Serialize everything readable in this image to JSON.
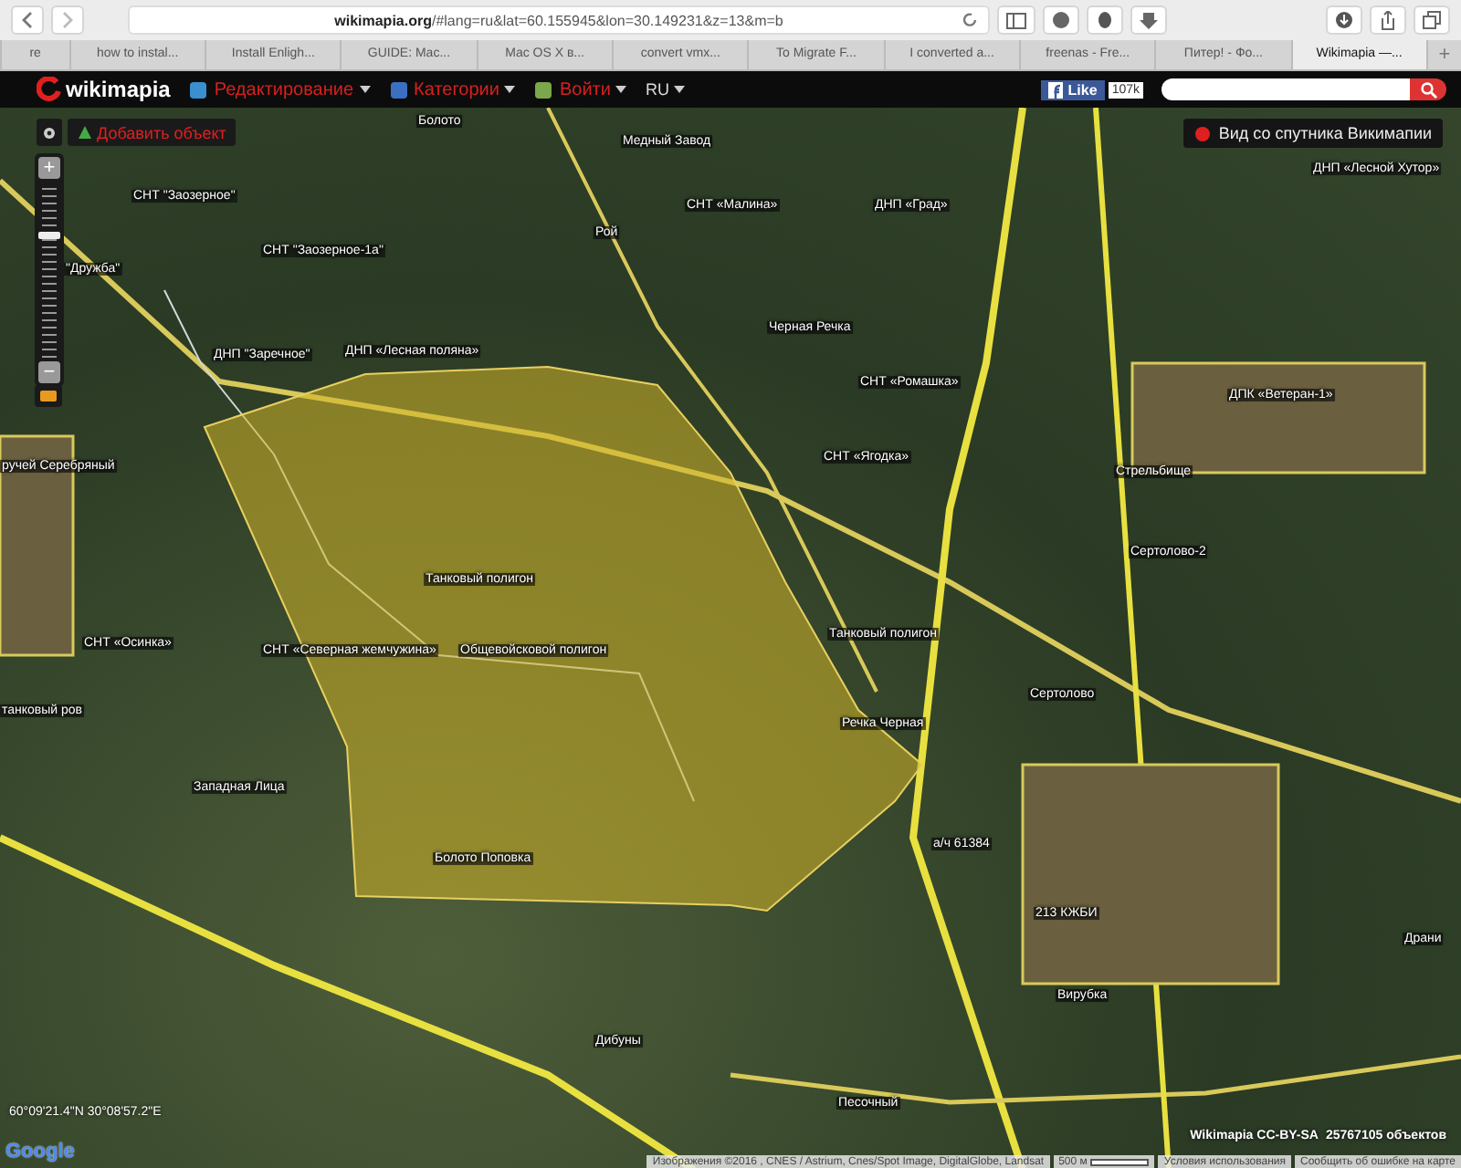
{
  "browser": {
    "url_host": "wikimapia.org",
    "url_rest": "/#lang=ru&lat=60.155945&lon=30.149231&z=13&m=b",
    "tabs": [
      {
        "label": "re",
        "selected": false
      },
      {
        "label": "how to instal...",
        "selected": false
      },
      {
        "label": "Install Enligh...",
        "selected": false
      },
      {
        "label": "GUIDE: Mac...",
        "selected": false
      },
      {
        "label": "Mac OS X в...",
        "selected": false
      },
      {
        "label": "convert vmx...",
        "selected": false
      },
      {
        "label": "To Migrate F...",
        "selected": false
      },
      {
        "label": "I converted a...",
        "selected": false
      },
      {
        "label": "freenas - Fre...",
        "selected": false
      },
      {
        "label": "Питер! - Фо...",
        "selected": false
      },
      {
        "label": "Wikimapia —...",
        "selected": true
      }
    ],
    "new_tab": "+"
  },
  "topbar": {
    "logo": "wikimapia",
    "menu": [
      {
        "label": "Редактирование",
        "kind": "edit"
      },
      {
        "label": "Категории",
        "kind": "categories"
      },
      {
        "label": "Войти",
        "kind": "login"
      }
    ],
    "language": "RU",
    "like_label": "Like",
    "like_count": "107k"
  },
  "map": {
    "add_object": "Добавить объект",
    "satellite_label": "Вид со спутника Викимапии",
    "zoom_plus": "+",
    "zoom_minus": "−",
    "zoom": {
      "level": 0.7
    },
    "labels": [
      {
        "text": "Болото"
      },
      {
        "text": "Медный Завод"
      },
      {
        "text": "ДНП «Лесной Хутор»"
      },
      {
        "text": "СНТ \"Заозерное\""
      },
      {
        "text": "СНТ «Малина»"
      },
      {
        "text": "ДНП «Град»"
      },
      {
        "text": "Рой"
      },
      {
        "text": "СНТ \"Заозерное-1а\""
      },
      {
        "text": "\"Дружба\""
      },
      {
        "text": "Черная Речка"
      },
      {
        "text": "ДНП \"Заречное\""
      },
      {
        "text": "ДНП «Лесная поляна»"
      },
      {
        "text": "СНТ «Ромашка»"
      },
      {
        "text": "ДПК «Ветеран-1»"
      },
      {
        "text": "СНТ «Ягодка»"
      },
      {
        "text": "ручей Серебряный"
      },
      {
        "text": "Стрельбище"
      },
      {
        "text": "Сертолово-2"
      },
      {
        "text": "Танковый полигон"
      },
      {
        "text": "Танковый полигон"
      },
      {
        "text": "СНТ «Осинка»"
      },
      {
        "text": "СНТ «Северная жемчужина»"
      },
      {
        "text": "Общевойсковой полигон"
      },
      {
        "text": "Сертолово"
      },
      {
        "text": "танковый ров"
      },
      {
        "text": "Речка Черная"
      },
      {
        "text": "Западная Лица"
      },
      {
        "text": "а/ч 61384"
      },
      {
        "text": "Болото Поповка"
      },
      {
        "text": "213 КЖБИ"
      },
      {
        "text": "Драни"
      },
      {
        "text": "Вирубка"
      },
      {
        "text": "Дибуны"
      },
      {
        "text": "Песочный"
      }
    ],
    "google_logo": "Google",
    "coordinates": "60°09'21.4\"N 30°08'57.2\"E",
    "license": "Wikimapia CC-BY-SA",
    "object_count": "25767105 объектов",
    "attribution": "Изображения ©2016 , CNES / Astrium, Cnes/Spot Image, DigitalGlobe, Landsat",
    "scale": "500 м",
    "terms": "Условия использования",
    "report": "Сообщить об ошибке на карте"
  }
}
